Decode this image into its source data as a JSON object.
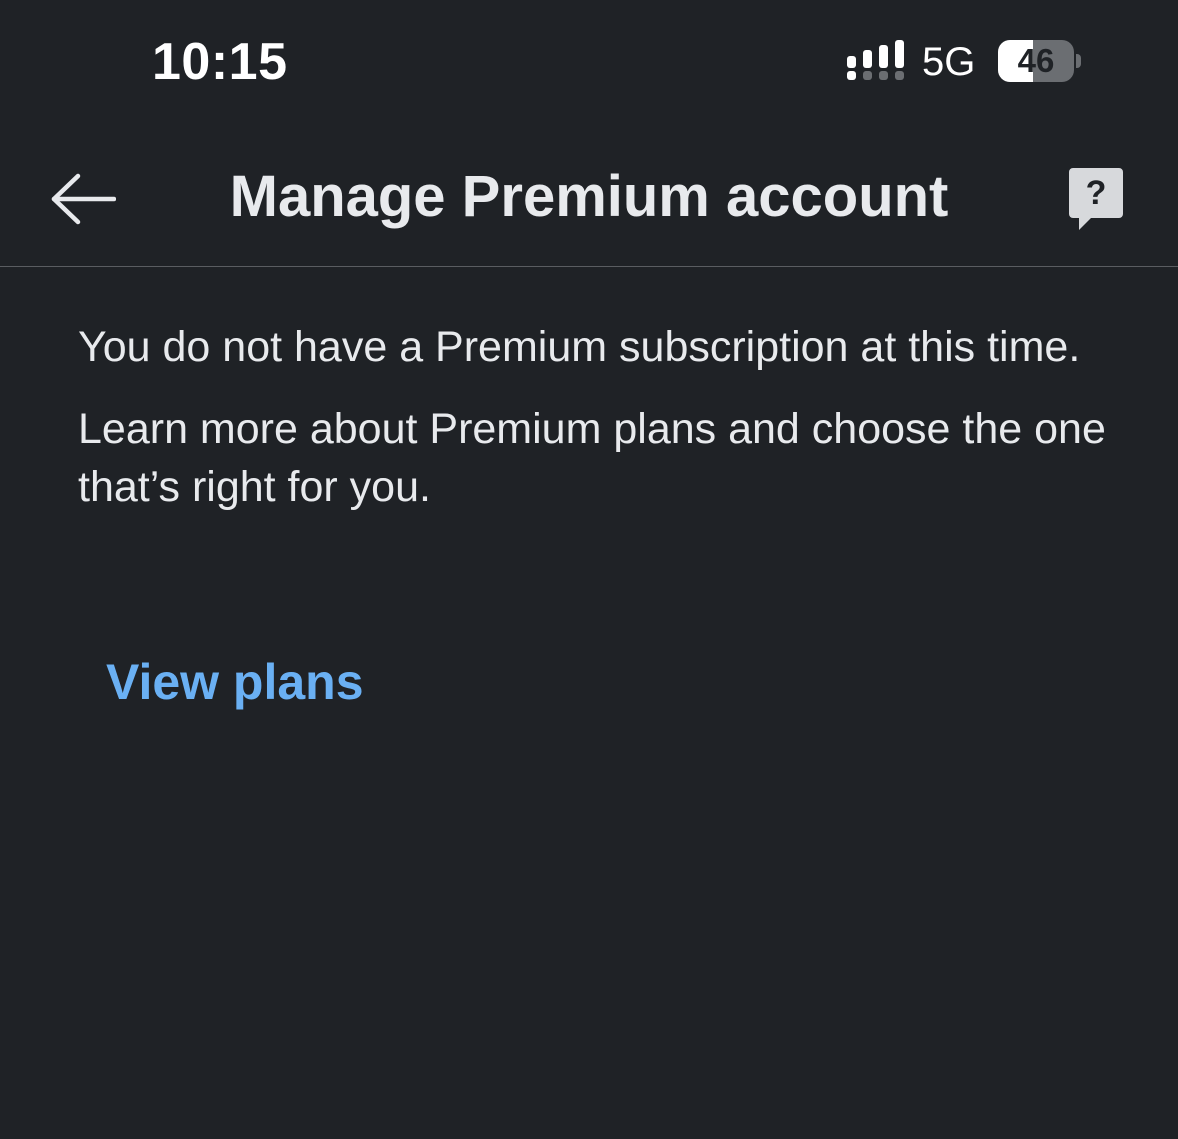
{
  "status_bar": {
    "time": "10:15",
    "network": "5G",
    "battery_level": "46",
    "battery_fraction": 0.46,
    "signal_bars_active": 4,
    "signal_bars_total": 4,
    "signal_icon": "cellular-signal-icon",
    "battery_icon": "battery-icon"
  },
  "app_bar": {
    "title": "Manage Premium account",
    "back_icon": "arrow-left-icon",
    "help_icon": "help-question-bubble-icon"
  },
  "content": {
    "message_1": "You do not have a Premium subscription at this time.",
    "message_2": "Learn more about Premium plans and choose the one that’s right for you.",
    "view_plans_label": "View plans"
  },
  "colors": {
    "background": "#1f2226",
    "text_primary": "#e8eaed",
    "link": "#6ab0f3",
    "divider": "#5a5d61"
  }
}
